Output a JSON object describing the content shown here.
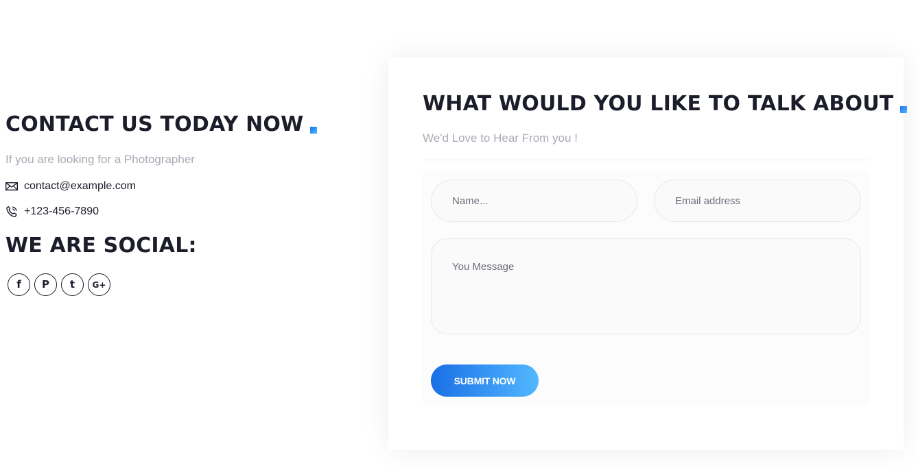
{
  "contact": {
    "title": "CONTACT US TODAY NOW",
    "subtitle": "If you are looking for a Photographer",
    "email": "contact@example.com",
    "phone": "+123-456-7890",
    "email_icon": "envelope-icon",
    "phone_icon": "phone-icon"
  },
  "social": {
    "title": "WE ARE SOCIAL:",
    "links": [
      {
        "icon": "facebook-icon",
        "glyph": "f"
      },
      {
        "icon": "pinterest-icon",
        "glyph": "P"
      },
      {
        "icon": "twitter-icon",
        "glyph": "t"
      },
      {
        "icon": "google-plus-icon",
        "glyph": "G+"
      }
    ]
  },
  "form": {
    "title": "WHAT WOULD YOU LIKE TO TALK ABOUT",
    "subtitle": "We'd Love to Hear From you !",
    "name_placeholder": "Name...",
    "email_placeholder": "Email address",
    "message_placeholder": "You Message",
    "submit_label": "SUBMIT NOW"
  },
  "colors": {
    "accent_start": "#1a73e8",
    "accent_end": "#4fb6ff",
    "heading": "#1b1d2a",
    "muted": "#a9aab4"
  }
}
